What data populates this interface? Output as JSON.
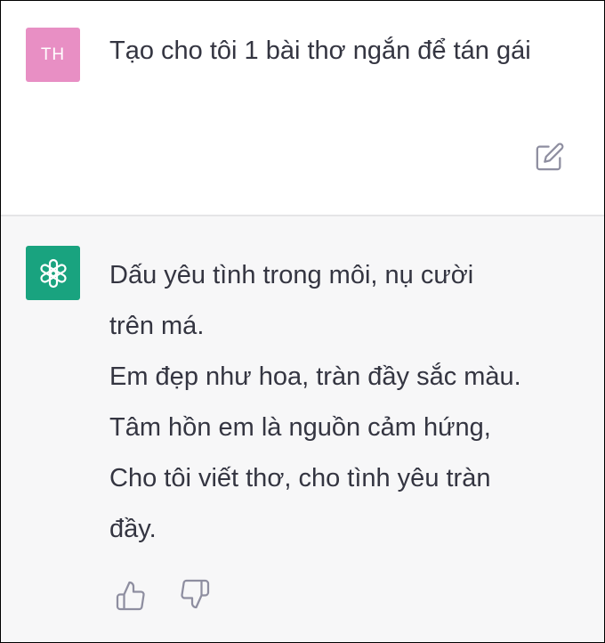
{
  "user_message": {
    "avatar_initials": "TH",
    "avatar_color": "#e88fc4",
    "text": "Tạo cho tôi 1 bài thơ ngắn để tán gái",
    "edit_icon": "edit-icon"
  },
  "assistant_message": {
    "avatar_icon": "openai-logo-icon",
    "avatar_color": "#19a37f",
    "lines": [
      "Dấu yêu tình trong môi, nụ cười",
      "trên má.",
      "Em đẹp như hoa, tràn đầy sắc màu.",
      "Tâm hồn em là nguồn cảm hứng,",
      "Cho tôi viết thơ, cho tình yêu tràn",
      "đầy."
    ],
    "feedback_icons": [
      "thumbs-up-icon",
      "thumbs-down-icon"
    ]
  },
  "colors": {
    "user_bg": "#ffffff",
    "assistant_bg": "#f7f7f8",
    "text": "#343541",
    "icon": "#8e8ea0"
  }
}
